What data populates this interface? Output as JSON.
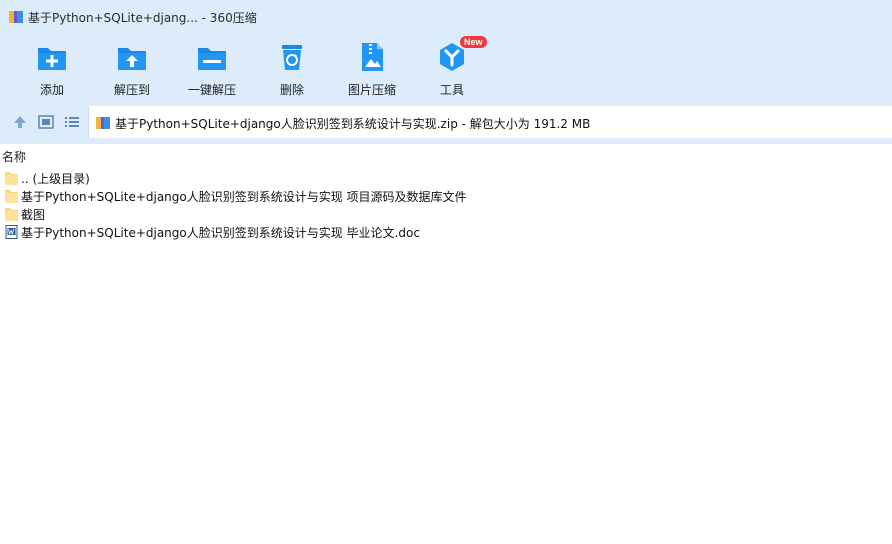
{
  "window": {
    "title": "基于Python+SQLite+djang... - 360压缩"
  },
  "toolbar": {
    "buttons": [
      {
        "label": "添加",
        "icon": "add-folder-icon"
      },
      {
        "label": "解压到",
        "icon": "extract-to-icon"
      },
      {
        "label": "一键解压",
        "icon": "one-click-extract-icon"
      },
      {
        "label": "删除",
        "icon": "recycle-bin-icon"
      },
      {
        "label": "图片压缩",
        "icon": "image-compress-icon"
      },
      {
        "label": "工具",
        "icon": "tools-icon",
        "badge": "New"
      }
    ]
  },
  "address": {
    "path": "基于Python+SQLite+django人脸识别签到系统设计与实现.zip - 解包大小为 191.2 MB"
  },
  "list": {
    "column_name": "名称",
    "items": [
      {
        "name": ".. (上级目录)",
        "type": "folder"
      },
      {
        "name": "基于Python+SQLite+django人脸识别签到系统设计与实现 项目源码及数据库文件",
        "type": "folder"
      },
      {
        "name": "截图",
        "type": "folder"
      },
      {
        "name": "基于Python+SQLite+django人脸识别签到系统设计与实现 毕业论文.doc",
        "type": "doc"
      }
    ]
  },
  "colors": {
    "chrome_bg": "#dcecfb",
    "icon_blue": "#1e88e5",
    "folder_yellow": "#f9d77e",
    "badge_red": "#ee3a3a"
  }
}
